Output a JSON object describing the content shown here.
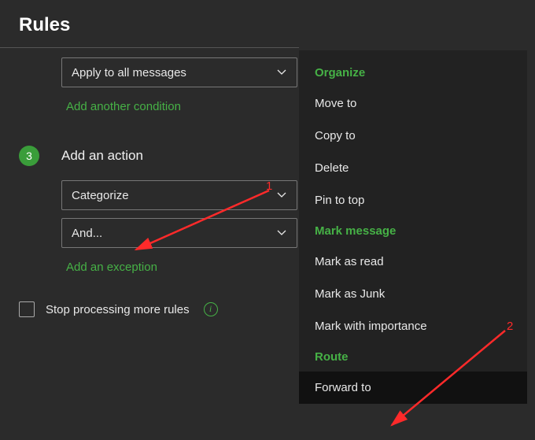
{
  "title": "Rules",
  "condition": {
    "dropdown_label": "Apply to all messages",
    "add_link": "Add another condition"
  },
  "step3": {
    "num": "3",
    "heading": "Add an action",
    "dropdown1": "Categorize",
    "dropdown2": "And...",
    "add_link": "Add an exception"
  },
  "stop": {
    "label": "Stop processing more rules"
  },
  "menu": {
    "section_organize": "Organize",
    "move": "Move to",
    "copy": "Copy to",
    "delete": "Delete",
    "pin": "Pin to top",
    "section_mark": "Mark message",
    "read": "Mark as read",
    "junk": "Mark as Junk",
    "importance": "Mark with importance",
    "section_route": "Route",
    "forward": "Forward to"
  },
  "annotations": {
    "one": "1",
    "two": "2"
  }
}
